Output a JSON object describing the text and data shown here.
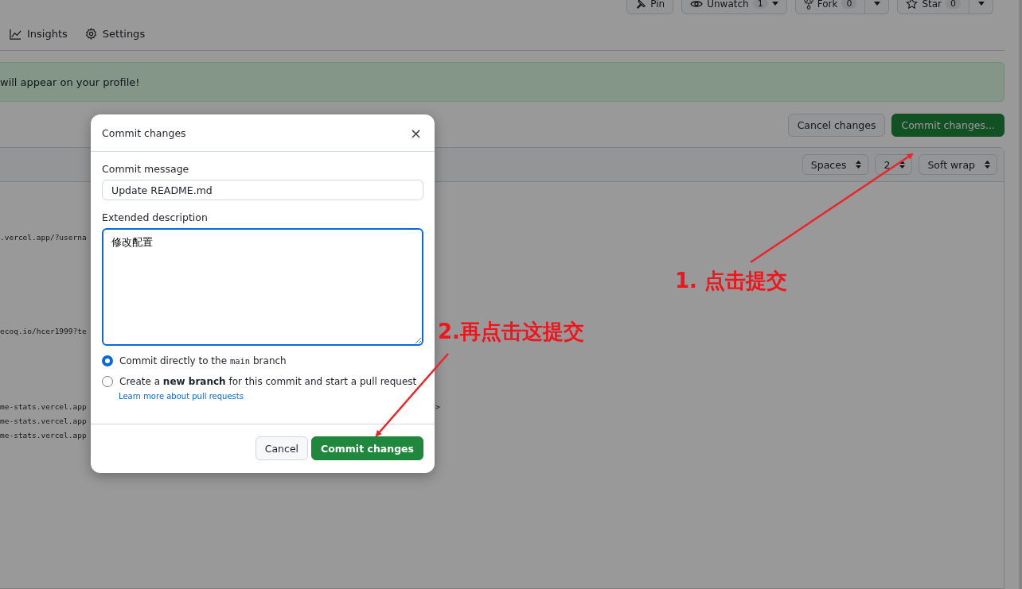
{
  "repo_actions": [
    {
      "kind": "plain",
      "label": "Pin"
    },
    {
      "kind": "menu",
      "label": "Unwatch",
      "count": "1"
    },
    {
      "kind": "split",
      "label": "Fork",
      "count": "0"
    },
    {
      "kind": "split",
      "label": "Star",
      "count": "0"
    }
  ],
  "nav": [
    {
      "label": "Insights"
    },
    {
      "label": "Settings"
    }
  ],
  "flash": {
    "text": "will appear on your profile!"
  },
  "editor_actions": [
    {
      "kind": "secondary",
      "label": "Cancel changes"
    },
    {
      "kind": "primary",
      "label": "Commit changes..."
    }
  ],
  "editor_toolbar": {
    "selects": [
      "Spaces",
      "2",
      "Soft wrap"
    ]
  },
  "code_blocks": [
    [
      ".vercel.app/?userna"
    ],
    [
      "ecoq.io/hcer1999?te"
    ],
    [
      "me-stats.vercel.app",
      "me-stats.vercel.app",
      "me-stats.vercel.app"
    ]
  ],
  "code_overflow_mark": ">",
  "dialog": {
    "title": "Commit changes",
    "close": "×",
    "message_label": "Commit message",
    "message_value": "Update README.md",
    "description_label": "Extended description",
    "description_value": "修改配置",
    "options": [
      {
        "selected": true,
        "parts": [
          {
            "kind": "text",
            "text": "Commit directly to the "
          },
          {
            "kind": "code",
            "text": "main"
          },
          {
            "kind": "text",
            "text": " branch"
          }
        ]
      },
      {
        "selected": false,
        "parts": [
          {
            "kind": "rich",
            "text": "Create a **new branch** for this commit and start a pull request"
          }
        ],
        "link": "Learn more about pull requests"
      }
    ],
    "buttons": [
      {
        "kind": "secondary",
        "label": "Cancel"
      },
      {
        "kind": "primary",
        "label": "Commit changes"
      }
    ]
  },
  "annotations": [
    {
      "text": "1. 点击提交"
    },
    {
      "text": "2.再点击这提交"
    }
  ]
}
